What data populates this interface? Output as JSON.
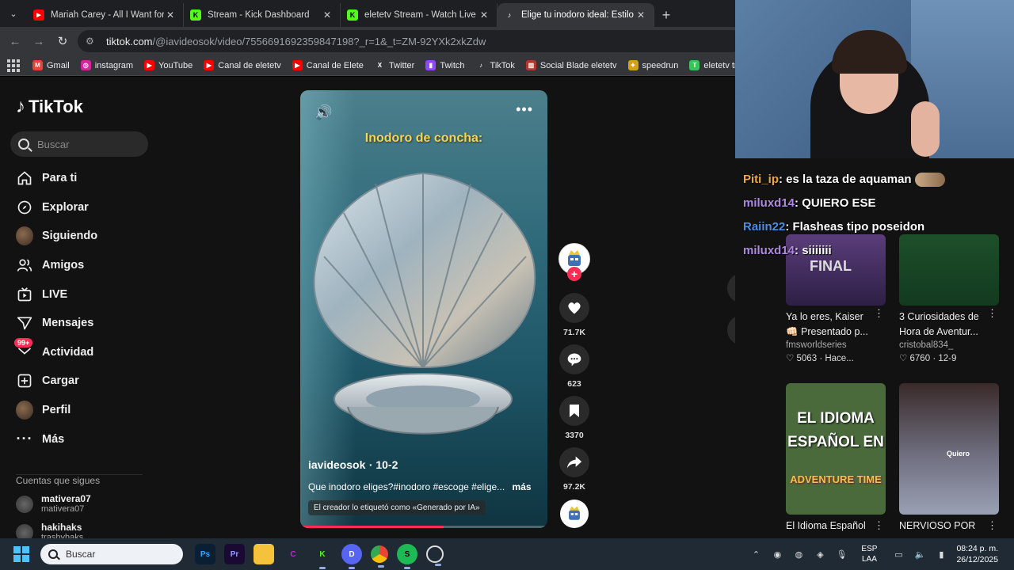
{
  "browser": {
    "tabs": [
      {
        "title": "Mariah Carey - All I Want for Chr",
        "favicon": "youtube-icon",
        "color": "#ff0000",
        "active": false
      },
      {
        "title": "Stream - Kick Dashboard",
        "favicon": "kick-icon",
        "color": "#53fc18",
        "active": false
      },
      {
        "title": "eletetv Stream - Watch Live on K",
        "favicon": "kick-icon",
        "color": "#53fc18",
        "active": false
      },
      {
        "title": "Elige tu inodoro ideal: Estilo y m",
        "favicon": "tiktok-icon",
        "color": "#ffffff",
        "active": true
      }
    ],
    "url_host": "tiktok.com",
    "url_rest": "/@iavideosok/video/7556691692359847198?_r=1&_t=ZM-92YXk2xkZdw",
    "bookmarks": [
      {
        "label": "Gmail",
        "icon": "gmail-icon",
        "color": "#ea4335"
      },
      {
        "label": "instagram",
        "icon": "instagram-icon",
        "color": "#d6249f"
      },
      {
        "label": "YouTube",
        "icon": "youtube-icon",
        "color": "#ff0000"
      },
      {
        "label": "Canal de eletetv",
        "icon": "youtube-icon",
        "color": "#ff0000"
      },
      {
        "label": "Canal de Elete",
        "icon": "youtube-icon",
        "color": "#ff0000"
      },
      {
        "label": "Twitter",
        "icon": "x-icon",
        "color": "#000000"
      },
      {
        "label": "Twitch",
        "icon": "twitch-icon",
        "color": "#9146ff"
      },
      {
        "label": "TikTok",
        "icon": "tiktok-icon",
        "color": "#000000"
      },
      {
        "label": "Social Blade eletetv",
        "icon": "socialblade-icon",
        "color": "#b3382c"
      },
      {
        "label": "speedrun",
        "icon": "speedrun-icon",
        "color": "#d4a017"
      },
      {
        "label": "eletetv tracker",
        "icon": "tracker-icon",
        "color": "#39c45a"
      }
    ]
  },
  "tiktok": {
    "logo": "TikTok",
    "search_placeholder": "Buscar",
    "nav": [
      {
        "label": "Para ti",
        "icon": "home-icon"
      },
      {
        "label": "Explorar",
        "icon": "compass-icon"
      },
      {
        "label": "Siguiendo",
        "icon": "avatar"
      },
      {
        "label": "Amigos",
        "icon": "friends-icon"
      },
      {
        "label": "LIVE",
        "icon": "live-icon"
      },
      {
        "label": "Mensajes",
        "icon": "send-icon"
      },
      {
        "label": "Actividad",
        "icon": "inbox-icon",
        "badge": "99+"
      },
      {
        "label": "Cargar",
        "icon": "upload-icon"
      },
      {
        "label": "Perfil",
        "icon": "avatar"
      },
      {
        "label": "Más",
        "icon": "more-icon"
      }
    ],
    "following_header": "Cuentas que sigues",
    "following": [
      {
        "username": "mativera07",
        "display": "mativera07"
      },
      {
        "username": "hakihaks",
        "display": "trashyhaks"
      }
    ],
    "video": {
      "overlay_text": "Inodoro de concha:",
      "author": "iavideosok",
      "date": "· 10-2",
      "description": "Que inodoro eliges?#inodoro #escoge #elige...",
      "more": "más",
      "ai_label": "El creador lo etiquetó como «Generado por IA»",
      "progress": 0.58
    },
    "actions": {
      "likes": "71.7K",
      "comments": "623",
      "saves": "3370",
      "shares": "97.2K"
    },
    "accent": "#fe2c55"
  },
  "chat": [
    {
      "user": "Piti_ip",
      "color": "#f2a93b",
      "text": ": es la taza de aquaman",
      "emote": true
    },
    {
      "user": "miluxd14",
      "color": "#b08ae0",
      "text": ": QUIERO ESE",
      "emote": false
    },
    {
      "user": "Raiin22",
      "color": "#4a8fe0",
      "text": ": Flasheas tipo poseidon",
      "emote": false
    },
    {
      "user": "miluxd14",
      "color": "#b08ae0",
      "text": ": siiiiiii",
      "emote": false
    }
  ],
  "related": [
    {
      "title": "Ya lo eres, Kaiser 👊🏻 Presentado p...",
      "line1": "Ya lo eres, Kaiser",
      "line2": "👊🏻 Presentado p...",
      "user": "fmsworldseries",
      "likes": "5063",
      "when": "Hace..."
    },
    {
      "title": "3 Curiosidades de Hora de Aventur...",
      "line1": "3 Curiosidades de",
      "line2": "Hora de Aventur...",
      "user": "cristobal834_",
      "likes": "6760",
      "when": "12-9"
    },
    {
      "title": "El Idioma Español",
      "line1": "El Idioma Español",
      "thumb_text": "EL IDIOMA ESPAÑOL EN",
      "thumb_sub": "ADVENTURE TIME"
    },
    {
      "title": "NERVIOSO POR",
      "line1": "NERVIOSO POR",
      "thumb_text": "Quiero"
    }
  ],
  "taskbar": {
    "search_placeholder": "Buscar",
    "apps": [
      {
        "name": "photoshop-icon",
        "label": "Ps",
        "color": "#0a1f33",
        "fg": "#31a8ff"
      },
      {
        "name": "premiere-icon",
        "label": "Pr",
        "color": "#1a0a33",
        "fg": "#9999ff"
      },
      {
        "name": "folder-icon",
        "label": "",
        "color": "#f5c33b",
        "fg": "#000"
      },
      {
        "name": "canva-icon",
        "label": "C",
        "color": "#202a34",
        "fg": "#c026d3"
      },
      {
        "name": "kick-icon",
        "label": "K",
        "color": "#202a34",
        "fg": "#53fc18"
      },
      {
        "name": "discord-icon",
        "label": "D",
        "color": "#5865f2",
        "fg": "#fff"
      },
      {
        "name": "chrome-icon",
        "label": "",
        "color": "#4285f4",
        "fg": "#fff"
      },
      {
        "name": "spotify-icon",
        "label": "S",
        "color": "#1db954",
        "fg": "#000"
      },
      {
        "name": "obs-icon",
        "label": "",
        "color": "#202a34",
        "fg": "#ddd"
      }
    ],
    "lang_top": "ESP",
    "lang_bottom": "LAA",
    "time": "08:24 p. m.",
    "date": "26/12/2025"
  }
}
